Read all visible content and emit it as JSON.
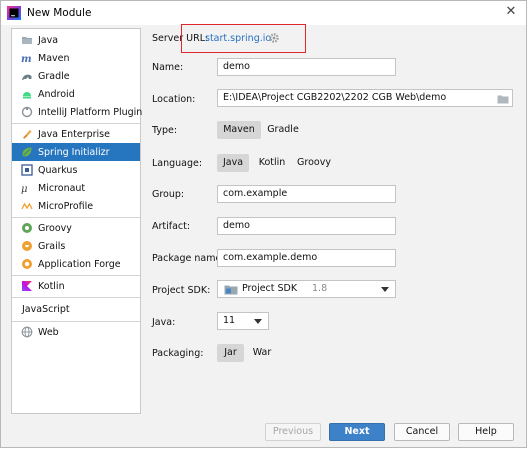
{
  "window": {
    "title": "New Module"
  },
  "sidebar": {
    "items": [
      {
        "label": "Java",
        "icon": "folder-java-icon"
      },
      {
        "label": "Maven",
        "icon": "maven-icon"
      },
      {
        "label": "Gradle",
        "icon": "gradle-icon"
      },
      {
        "label": "Android",
        "icon": "android-icon"
      },
      {
        "label": "IntelliJ Platform Plugin",
        "icon": "plugin-icon"
      },
      {
        "label": "Java Enterprise",
        "icon": "java-enterprise-icon"
      },
      {
        "label": "Spring Initializr",
        "icon": "spring-icon",
        "selected": true
      },
      {
        "label": "Quarkus",
        "icon": "quarkus-icon"
      },
      {
        "label": "Micronaut",
        "icon": "micronaut-icon"
      },
      {
        "label": "MicroProfile",
        "icon": "microprofile-icon"
      },
      {
        "label": "Groovy",
        "icon": "groovy-icon"
      },
      {
        "label": "Grails",
        "icon": "grails-icon"
      },
      {
        "label": "Application Forge",
        "icon": "application-forge-icon"
      },
      {
        "label": "Kotlin",
        "icon": "kotlin-icon"
      },
      {
        "label": "JavaScript",
        "icon": ""
      },
      {
        "label": "Web",
        "icon": "web-icon"
      }
    ]
  },
  "form": {
    "server_url_label": "Server URL:",
    "server_url": "start.spring.io",
    "name_label": "Name:",
    "name_value": "demo",
    "location_label": "Location:",
    "location_value": "E:\\IDEA\\Project CGB2202\\2202 CGB Web\\demo",
    "type_label": "Type:",
    "type_options": [
      "Maven",
      "Gradle"
    ],
    "type_selected": "Maven",
    "language_label": "Language:",
    "language_options": [
      "Java",
      "Kotlin",
      "Groovy"
    ],
    "language_selected": "Java",
    "group_label": "Group:",
    "group_value": "com.example",
    "artifact_label": "Artifact:",
    "artifact_value": "demo",
    "package_label": "Package name:",
    "package_value": "com.example.demo",
    "sdk_label": "Project SDK:",
    "sdk_name": "Project SDK",
    "sdk_version": "1.8",
    "java_label": "Java:",
    "java_value": "11",
    "packaging_label": "Packaging:",
    "packaging_options": [
      "Jar",
      "War"
    ],
    "packaging_selected": "Jar"
  },
  "buttons": {
    "previous": "Previous",
    "next": "Next",
    "cancel": "Cancel",
    "help": "Help"
  },
  "colors": {
    "selection": "#2675bf",
    "link": "#2770c0",
    "highlight_box": "#e0282c",
    "primary_button": "#3d82c9"
  }
}
